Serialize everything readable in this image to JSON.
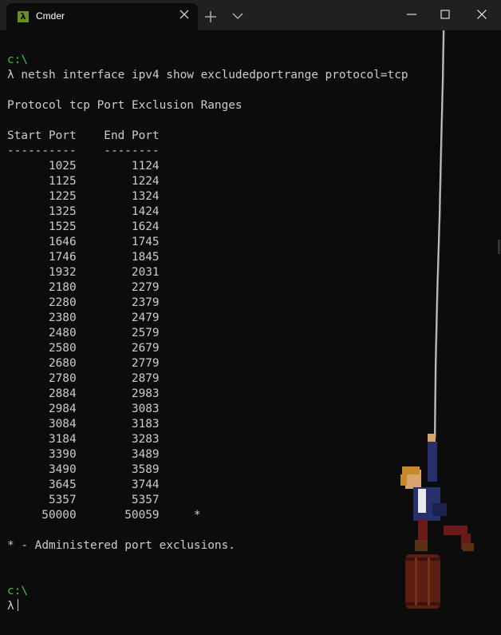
{
  "window": {
    "tab_title": "Cmder",
    "tab_icon_glyph": "λ"
  },
  "terminal": {
    "prompt_path": "c:\\",
    "prompt_symbol": "λ",
    "command": "netsh interface ipv4 show excludedportrange protocol=tcp",
    "header": "Protocol tcp Port Exclusion Ranges",
    "col_start": "Start Port",
    "col_end": "End Port",
    "sep_start": "----------",
    "sep_end": "--------",
    "rows": [
      {
        "start": "1025",
        "end": "1124",
        "mark": ""
      },
      {
        "start": "1125",
        "end": "1224",
        "mark": ""
      },
      {
        "start": "1225",
        "end": "1324",
        "mark": ""
      },
      {
        "start": "1325",
        "end": "1424",
        "mark": ""
      },
      {
        "start": "1525",
        "end": "1624",
        "mark": ""
      },
      {
        "start": "1646",
        "end": "1745",
        "mark": ""
      },
      {
        "start": "1746",
        "end": "1845",
        "mark": ""
      },
      {
        "start": "1932",
        "end": "2031",
        "mark": ""
      },
      {
        "start": "2180",
        "end": "2279",
        "mark": ""
      },
      {
        "start": "2280",
        "end": "2379",
        "mark": ""
      },
      {
        "start": "2380",
        "end": "2479",
        "mark": ""
      },
      {
        "start": "2480",
        "end": "2579",
        "mark": ""
      },
      {
        "start": "2580",
        "end": "2679",
        "mark": ""
      },
      {
        "start": "2680",
        "end": "2779",
        "mark": ""
      },
      {
        "start": "2780",
        "end": "2879",
        "mark": ""
      },
      {
        "start": "2884",
        "end": "2983",
        "mark": ""
      },
      {
        "start": "2984",
        "end": "3083",
        "mark": ""
      },
      {
        "start": "3084",
        "end": "3183",
        "mark": ""
      },
      {
        "start": "3184",
        "end": "3283",
        "mark": ""
      },
      {
        "start": "3390",
        "end": "3489",
        "mark": ""
      },
      {
        "start": "3490",
        "end": "3589",
        "mark": ""
      },
      {
        "start": "3645",
        "end": "3744",
        "mark": ""
      },
      {
        "start": "5357",
        "end": "5357",
        "mark": ""
      },
      {
        "start": "50000",
        "end": "50059",
        "mark": "*"
      }
    ],
    "footnote": "* - Administered port exclusions."
  },
  "colors": {
    "background": "#0c0c0c",
    "titlebar": "#202020",
    "text": "#cccccc",
    "prompt_path": "#39c63b"
  },
  "icons": [
    "lambda-icon",
    "close-icon",
    "plus-icon",
    "chevron-down-icon",
    "minimize-icon",
    "maximize-icon"
  ]
}
